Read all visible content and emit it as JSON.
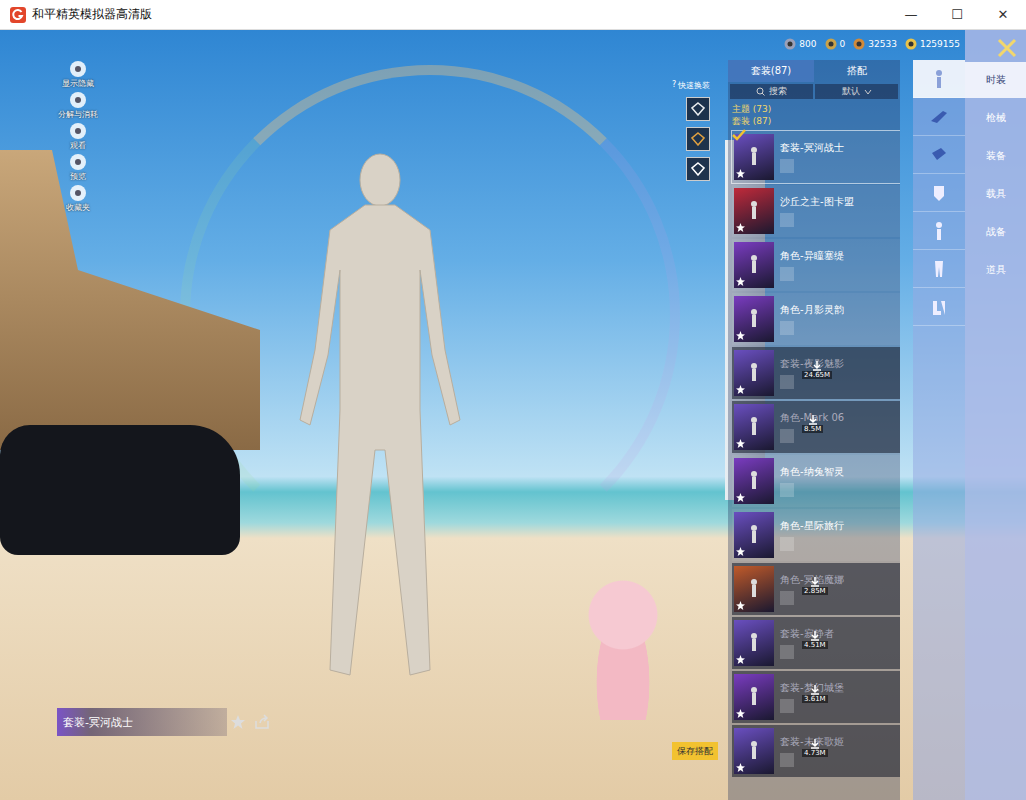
{
  "window": {
    "title": "和平精英模拟器高清版",
    "controls": [
      "—",
      "☐",
      "✕"
    ]
  },
  "currencies": [
    {
      "value": "800",
      "color": "#9aa0b8"
    },
    {
      "value": "0",
      "color": "#c9a24a"
    },
    {
      "value": "32533",
      "color": "#d08a3a"
    },
    {
      "value": "1259155",
      "color": "#e8c24a"
    }
  ],
  "left_tools": [
    {
      "label": "显示隐藏"
    },
    {
      "label": "分解与消耗"
    },
    {
      "label": "观看"
    },
    {
      "label": "预览"
    },
    {
      "label": "收藏夹"
    }
  ],
  "quick_change": {
    "help": "?",
    "label": "快速换装"
  },
  "panel": {
    "tabs": [
      {
        "label": "套装(87)",
        "selected": true
      },
      {
        "label": "搭配",
        "selected": false
      }
    ],
    "search": "搜索",
    "sort": "默认",
    "filters": [
      {
        "label": "主题 (73)"
      },
      {
        "label": "套装 (87)"
      }
    ],
    "items": [
      {
        "name": "套装-冥河战士",
        "selected": true,
        "downloaded": false,
        "size": "",
        "color": "#6a4fc0"
      },
      {
        "name": "沙丘之主-图卡盟",
        "selected": false,
        "downloaded": false,
        "size": "",
        "color": "#c02a3a"
      },
      {
        "name": "角色-异瞳塞缇",
        "selected": false,
        "downloaded": false,
        "size": "",
        "color": "#7a3cc0"
      },
      {
        "name": "角色-月影灵韵",
        "selected": false,
        "downloaded": false,
        "size": "",
        "color": "#7a3cc0"
      },
      {
        "name": "套装-夜影魅影",
        "selected": false,
        "downloaded": true,
        "size": "24.65M",
        "color": "#6a4fc0"
      },
      {
        "name": "角色-Mark 06",
        "selected": false,
        "downloaded": true,
        "size": "8.5M",
        "color": "#6a4fc0"
      },
      {
        "name": "角色-纳兔智灵",
        "selected": false,
        "downloaded": false,
        "size": "",
        "color": "#7a3cc0"
      },
      {
        "name": "角色-星际旅行",
        "selected": false,
        "downloaded": false,
        "size": "",
        "color": "#6a4fc0"
      },
      {
        "name": "角色-冥焰魔娜",
        "selected": false,
        "downloaded": true,
        "size": "2.85M",
        "color": "#c05a2a"
      },
      {
        "name": "套装-寂静者",
        "selected": false,
        "downloaded": true,
        "size": "4.51M",
        "color": "#6a4fc0"
      },
      {
        "name": "套装-梦幻城堡",
        "selected": false,
        "downloaded": true,
        "size": "3.61M",
        "color": "#7a3cc0"
      },
      {
        "name": "套装-未来歌姬",
        "selected": false,
        "downloaded": true,
        "size": "4.73M",
        "color": "#6a4fc0"
      }
    ]
  },
  "category_icons": [
    {
      "selected": true
    },
    {
      "selected": false
    },
    {
      "selected": false
    },
    {
      "selected": false
    },
    {
      "selected": false
    },
    {
      "selected": false
    },
    {
      "selected": false
    }
  ],
  "categories": [
    {
      "label": "时装",
      "selected": true
    },
    {
      "label": "枪械",
      "selected": false
    },
    {
      "label": "装备",
      "selected": false
    },
    {
      "label": "载具",
      "selected": false
    },
    {
      "label": "战备",
      "selected": false
    },
    {
      "label": "道具",
      "selected": false
    }
  ],
  "current_outfit": {
    "name": "套装-冥河战士"
  },
  "save_button": "保存搭配"
}
